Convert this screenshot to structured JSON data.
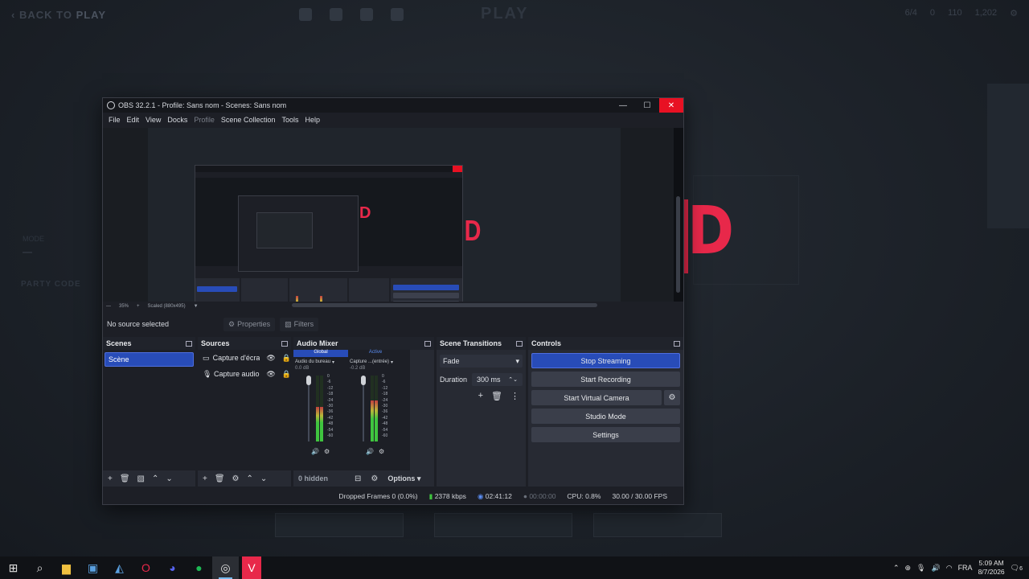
{
  "background": {
    "back_label": "BACK TO",
    "back_bold": "PLAY",
    "center_title": "PLAY",
    "party_code_label": "PARTY CODE",
    "right_counts": [
      "6/4",
      "0",
      "110",
      "1,202"
    ],
    "big_letter": "D"
  },
  "obs": {
    "window_title": "OBS 32.2.1 - Profile: Sans nom - Scenes: Sans nom",
    "menu": [
      "File",
      "Edit",
      "View",
      "Docks",
      "Profile",
      "Scene Collection",
      "Tools",
      "Help"
    ],
    "preview": {
      "zoom": "35%",
      "scale_label": "Scaled (880x495)",
      "nested_letter": "D"
    },
    "source_toolbar": {
      "no_source": "No source selected",
      "properties": "Properties",
      "filters": "Filters"
    },
    "scenes": {
      "title": "Scenes",
      "items": [
        "Scène"
      ]
    },
    "sources": {
      "title": "Sources",
      "items": [
        {
          "label": "Capture d'écra",
          "icon": "monitor-icon"
        },
        {
          "label": "Capture audio",
          "icon": "microphone-icon"
        }
      ]
    },
    "mixer": {
      "title": "Audio Mixer",
      "tab_global": "Global",
      "tab_active": "Active",
      "channels": [
        {
          "name": "Audio du bureau",
          "db": "0.0 dB",
          "level": 0.52
        },
        {
          "name": "Capture ...(entrée)",
          "db": "-0.2 dB",
          "level": 0.62
        }
      ],
      "scale": [
        "0",
        "-6",
        "-12",
        "-18",
        "-24",
        "-30",
        "-36",
        "-42",
        "-48",
        "-54",
        "-60"
      ],
      "hidden": "0 hidden",
      "options": "Options"
    },
    "transitions": {
      "title": "Scene Transitions",
      "selected": "Fade",
      "duration_label": "Duration",
      "duration_value": "300 ms"
    },
    "controls": {
      "title": "Controls",
      "stop_streaming": "Stop Streaming",
      "start_recording": "Start Recording",
      "start_virtual_camera": "Start Virtual Camera",
      "studio_mode": "Studio Mode",
      "settings": "Settings"
    },
    "status": {
      "dropped_frames": "Dropped Frames 0 (0.0%)",
      "bitrate": "2378 kbps",
      "stream_time": "02:41:12",
      "rec_time": "00:00:00",
      "cpu": "CPU: 0.8%",
      "fps": "30.00 / 30.00 FPS"
    }
  },
  "taskbar": {
    "apps": [
      "start-icon",
      "search-icon",
      "file-explorer-icon",
      "store-icon",
      "app-icon",
      "opera-gx-icon",
      "discord-icon",
      "spotify-icon",
      "obs-icon",
      "valorant-icon"
    ],
    "language": "FRA",
    "time": "5:09 AM",
    "date": "8/7/2026",
    "notifications": "6"
  }
}
